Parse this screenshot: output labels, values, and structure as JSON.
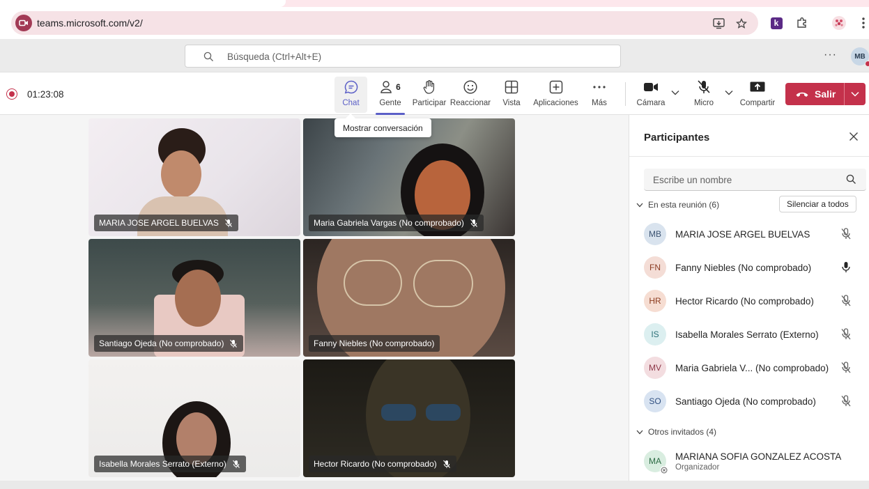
{
  "browser": {
    "url": "teams.microsoft.com/v2/",
    "extension_label": "k"
  },
  "header": {
    "search_placeholder": "Búsqueda (Ctrl+Alt+E)",
    "more_label": "···",
    "user_initials": "MB"
  },
  "meeting": {
    "timer": "01:23:08",
    "toolbar": {
      "chat": "Chat",
      "people": "Gente",
      "people_count": "6",
      "raise": "Participar",
      "react": "Reaccionar",
      "view": "Vista",
      "apps": "Aplicaciones",
      "more": "Más",
      "camera": "Cámara",
      "mic": "Micro",
      "share": "Compartir",
      "leave": "Salir"
    },
    "tooltip": "Mostrar conversación"
  },
  "tiles": [
    {
      "name": "MARIA JOSE ARGEL BUELVAS"
    },
    {
      "name": "Maria Gabriela Vargas (No comprobado)"
    },
    {
      "name": "Santiago Ojeda (No comprobado)"
    },
    {
      "name": "Fanny Niebles (No comprobado)"
    },
    {
      "name": "Isabella Morales Serrato (Externo)"
    },
    {
      "name": "Hector Ricardo (No comprobado)"
    }
  ],
  "panel": {
    "title": "Participantes",
    "search_placeholder": "Escribe un nombre",
    "in_meeting_label": "En esta reunión (6)",
    "mute_all": "Silenciar a todos",
    "participants": [
      {
        "initials": "MB",
        "name": "MARIA JOSE ARGEL BUELVAS",
        "mic": "muted",
        "color": "#d9e3ee",
        "text_color": "#3b5372"
      },
      {
        "initials": "FN",
        "name": "Fanny Niebles (No comprobado)",
        "mic": "on",
        "color": "#f4ddd6",
        "text_color": "#8a3b22"
      },
      {
        "initials": "HR",
        "name": "Hector Ricardo (No comprobado)",
        "mic": "muted",
        "color": "#f6ddd2",
        "text_color": "#8b3a1d"
      },
      {
        "initials": "IS",
        "name": "Isabella Morales Serrato (Externo)",
        "mic": "muted",
        "color": "#dceff0",
        "text_color": "#2b6f77"
      },
      {
        "initials": "MV",
        "name": "Maria Gabriela V...  (No comprobado)",
        "mic": "muted",
        "color": "#f3dde0",
        "text_color": "#8e3849"
      },
      {
        "initials": "SO",
        "name": "Santiago Ojeda (No comprobado)",
        "mic": "muted",
        "color": "#d8e3f1",
        "text_color": "#2f4f80"
      }
    ],
    "others_label": "Otros invitados (4)",
    "invited": {
      "initials": "MA",
      "name": "MARIANA SOFIA GONZALEZ ACOSTA",
      "role": "Organizador",
      "color": "#d9ede0",
      "text_color": "#2c6b44"
    }
  }
}
